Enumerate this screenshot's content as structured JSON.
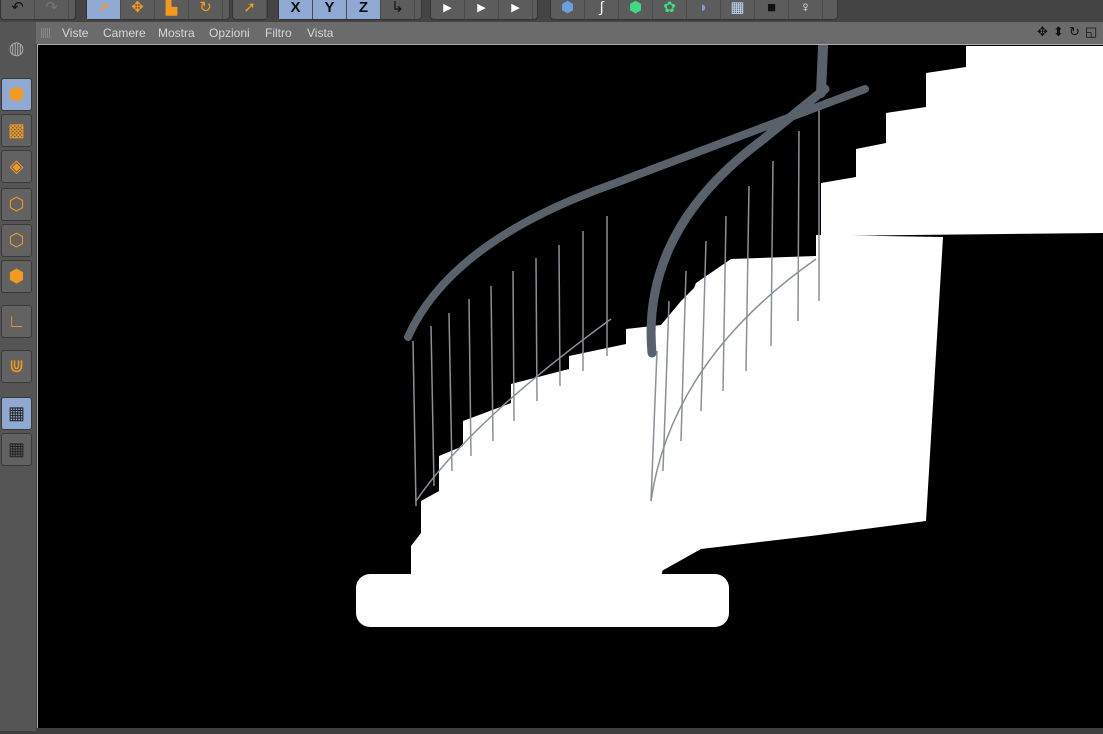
{
  "toolbar": {
    "groups": [
      [
        "undo-icon",
        "redo-icon"
      ],
      [
        "live-select-icon",
        "move-icon",
        "scale-icon",
        "rotate-icon"
      ],
      [
        "last-tool-icon"
      ],
      [
        "x-axis-lock-icon",
        "y-axis-lock-icon",
        "z-axis-lock-icon",
        "coordinate-system-icon"
      ],
      [
        "render-view-icon",
        "render-picture-viewer-icon",
        "render-settings-icon"
      ],
      [
        "cube-primitive-icon",
        "spline-pen-icon",
        "nurbs-icon",
        "mograph-cloner-icon",
        "deformer-icon",
        "floor-environment-icon",
        "camera-icon",
        "light-icon"
      ]
    ],
    "axis_labels": [
      "X",
      "Y",
      "Z"
    ]
  },
  "sidebar": {
    "tools": [
      "make-editable-icon",
      "model-mode-icon",
      "texture-mode-icon",
      "workplane-mode-icon",
      "points-mode-icon",
      "edges-mode-icon",
      "polygons-mode-icon",
      "axis-mode-icon",
      "snapping-icon",
      "locked-workplane-icon",
      "planar-workplane-icon"
    ]
  },
  "viewport": {
    "menus": [
      "Viste",
      "Camere",
      "Mostra",
      "Opzioni",
      "Filtro",
      "Vista"
    ],
    "nav_icons": [
      "pan-icon",
      "zoom-dolly-icon",
      "orbit-icon",
      "maximize-viewport-icon"
    ],
    "nav_glyphs": [
      "✥",
      "⬍",
      "↻",
      "◱"
    ]
  }
}
